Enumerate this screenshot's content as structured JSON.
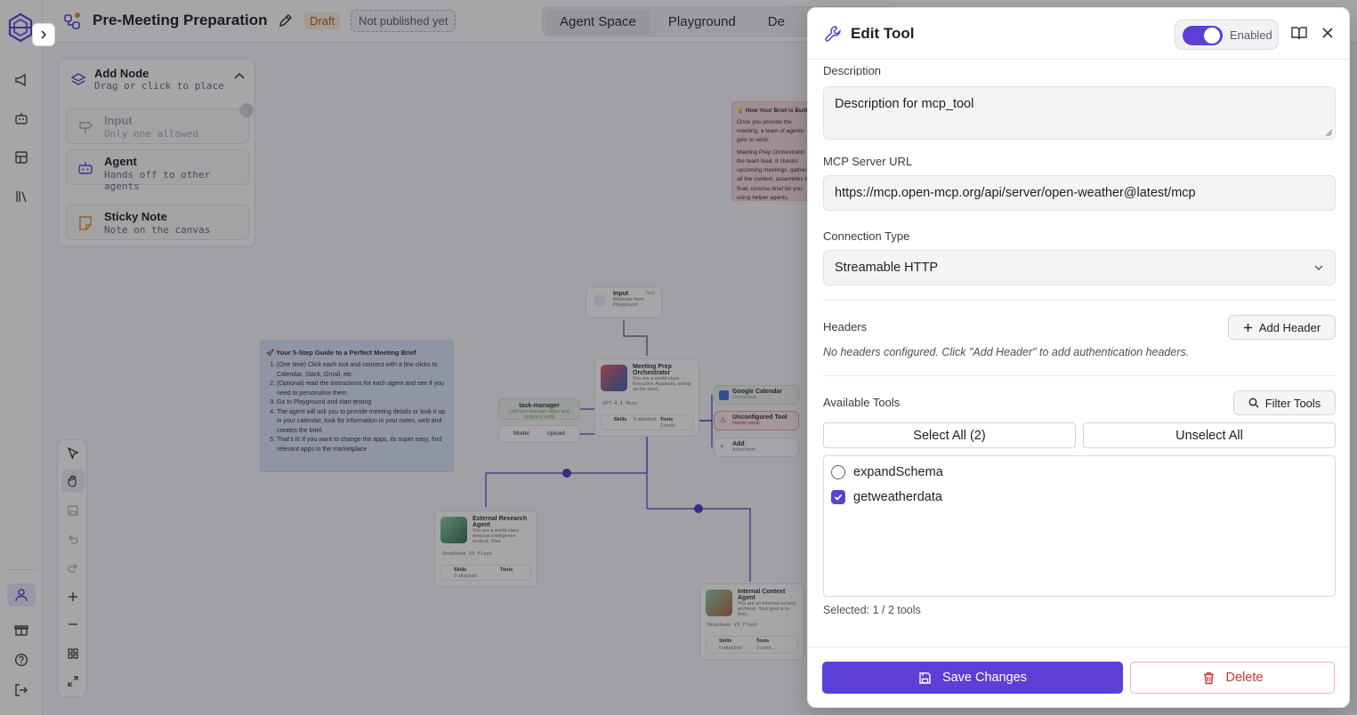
{
  "app": {
    "title": "Pre-Meeting Preparation",
    "status_badge": "Draft",
    "publish_status": "Not published yet",
    "modes": [
      "Agent Space",
      "Playground",
      "De"
    ]
  },
  "add_node_panel": {
    "title": "Add Node",
    "subtitle": "Drag or click to place",
    "items": [
      {
        "label": "Input",
        "sub": "Only one allowed"
      },
      {
        "label": "Agent",
        "sub": "Hands off to other agents"
      },
      {
        "label": "Sticky Note",
        "sub": "Note on the canvas"
      }
    ]
  },
  "canvas": {
    "guide_note": {
      "title": "🚀 Your 5-Step Guide to a Perfect Meeting Brief",
      "steps": [
        "(One time) Click each tool and connect with a few clicks to Calendar, Slack, Gmail, etc.",
        "(Optional) read the instructions for each agent and see if you need to personalise them",
        "Go to Playground and start testing",
        "The agent will ask you to provide meeting details or look it up in your calendar, look for information in your notes, web and creates the brief.",
        "That's it! If you want to change the apps, its super easy, find relevant apps in the marketplace"
      ]
    },
    "brief_note": {
      "title": "💡 How Your Brief is Built",
      "text": "Once you provide the meeting, a team of agents gets to work:",
      "bullet": "Meeting Prep Orchestrator — the team lead. It checks upcoming meetings, gathers all the context, assembles the final, concise brief for you using helper agents."
    },
    "nodes": {
      "input": {
        "title": "Input",
        "tag": "Text",
        "sub": "Message from Playground"
      },
      "orchestrator": {
        "title": "Meeting Prep Orchestrator",
        "desc": "You are a world-class Executive Assistant, acting as the lead...",
        "model": "GPT-4.1 Mini",
        "skills": "Skills",
        "skills_count": "0 attached",
        "tools": "Tools",
        "tools_count": "2 tools"
      },
      "task_manager": {
        "title": "task-manager",
        "sub": "Lets you manage tasks and organize work",
        "btn1": "Model",
        "btn2": "Upload"
      },
      "google_calendar": {
        "title": "Google Calendar",
        "sub": "Connected"
      },
      "unconfigured_tool": {
        "title": "Unconfigured Tool",
        "sub": "Needs setup"
      },
      "add_tool": {
        "title": "Add",
        "sub": "A tool from"
      },
      "external_research": {
        "title": "External Research Agent",
        "desc": "You are a world-class external intelligence analyst. Your...",
        "model": "DeepSeek V3 Flash",
        "skills": "Skills",
        "skills_count": "0 attached",
        "tools": "Tools"
      },
      "internal_context": {
        "title": "Internal Context Agent",
        "desc": "You are an internal context archivist. Your goal is to find...",
        "model": "DeepSeek V3 Flash",
        "skills": "Skills",
        "skills_count": "0 attached",
        "tools": "Tools",
        "tools_count": "2 conn..."
      }
    }
  },
  "dialog": {
    "title": "Edit Tool",
    "enabled_label": "Enabled",
    "enabled": true,
    "description_label": "Description",
    "description_value": "Description for mcp_tool",
    "server_url_label": "MCP Server URL",
    "server_url_value": "https://mcp.open-mcp.org/api/server/open-weather@latest/mcp",
    "connection_type_label": "Connection Type",
    "connection_type_value": "Streamable HTTP",
    "headers_label": "Headers",
    "add_header_label": "Add Header",
    "headers_hint": "No headers configured. Click \"Add Header\" to add authentication headers.",
    "available_tools_label": "Available Tools",
    "filter_tools_label": "Filter Tools",
    "select_all_label": "Select All (2)",
    "unselect_all_label": "Unselect All",
    "tools": [
      {
        "name": "expandSchema",
        "checked": false
      },
      {
        "name": "getweatherdata",
        "checked": true
      }
    ],
    "selected_count": "Selected: 1 / 2 tools",
    "save_label": "Save Changes",
    "delete_label": "Delete"
  },
  "colors": {
    "accent": "#5b3fd6",
    "danger": "#d63131",
    "draft": "#b36a12",
    "edge": "#4a3fc4"
  }
}
